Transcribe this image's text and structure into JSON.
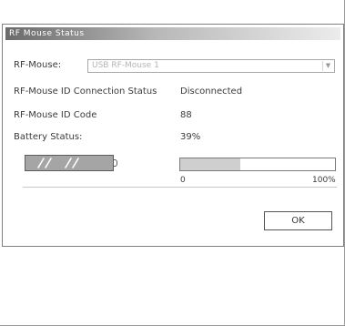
{
  "dialog": {
    "title": "RF Mouse Status",
    "rf_mouse_label": "RF-Mouse:",
    "rf_mouse_value": "USB RF-Mouse 1",
    "connection_label": "RF-Mouse ID Connection Status",
    "connection_value": "Disconnected",
    "id_code_label": "RF-Mouse ID Code",
    "id_code_value": "88",
    "battery_label": "Battery Status:",
    "battery_value": "39%",
    "battery_level": 0.39,
    "scale_min": "0",
    "scale_max": "100%",
    "ok_label": "OK"
  }
}
